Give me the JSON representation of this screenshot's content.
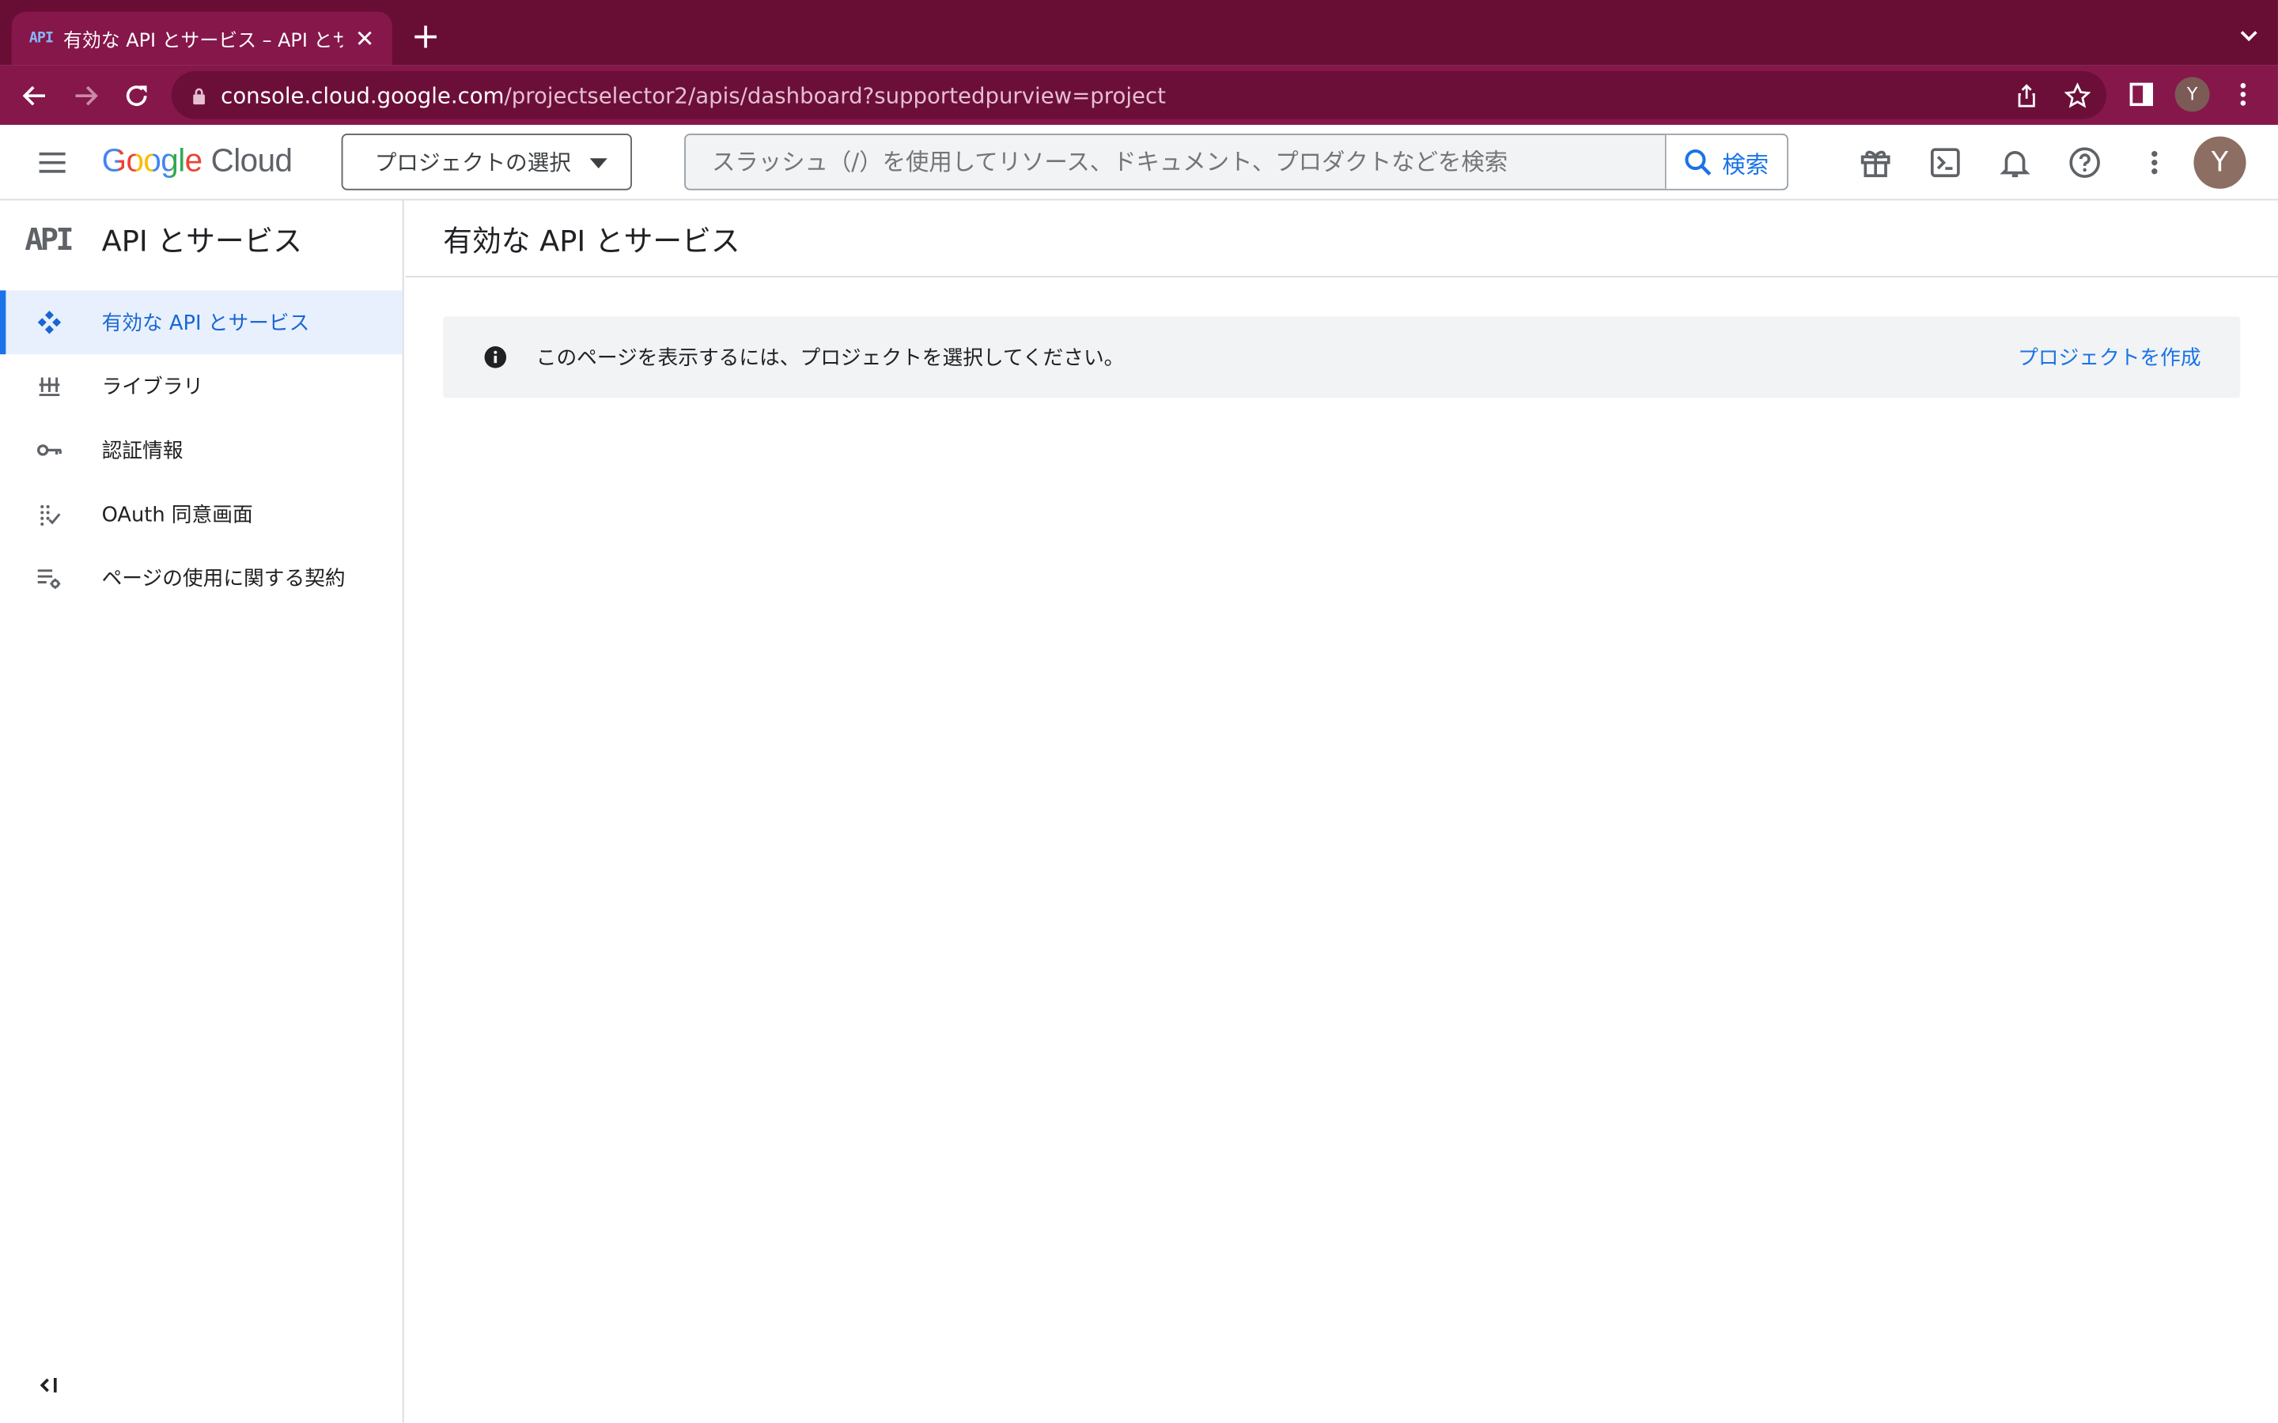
{
  "browser": {
    "tab_favicon": "API",
    "tab_title": "有効な API とサービス – API とサ",
    "url_host": "console.cloud.google.com",
    "url_path": "/projectselector2/apis/dashboard?supportedpurview=project",
    "profile_initial": "Y"
  },
  "header": {
    "logo_google": "Google",
    "logo_cloud": "Cloud",
    "project_selector": "プロジェクトの選択",
    "search_placeholder": "スラッシュ（/）を使用してリソース、ドキュメント、プロダクトなどを検索",
    "search_button": "検索",
    "avatar_initial": "Y"
  },
  "sidebar": {
    "icon_text": "API",
    "title": "API とサービス",
    "items": [
      {
        "label": "有効な API とサービス",
        "icon": "apis-dashboard-icon",
        "active": true
      },
      {
        "label": "ライブラリ",
        "icon": "library-icon",
        "active": false
      },
      {
        "label": "認証情報",
        "icon": "key-icon",
        "active": false
      },
      {
        "label": "OAuth 同意画面",
        "icon": "oauth-consent-icon",
        "active": false
      },
      {
        "label": "ページの使用に関する契約",
        "icon": "page-usage-settings-icon",
        "active": false
      }
    ]
  },
  "main": {
    "title": "有効な API とサービス",
    "banner_text": "このページを表示するには、プロジェクトを選択してください。",
    "banner_link": "プロジェクトを作成"
  },
  "colors": {
    "browser_frame": "#680d33",
    "browser_toolbar": "#86174a",
    "accent": "#1a73e8"
  }
}
